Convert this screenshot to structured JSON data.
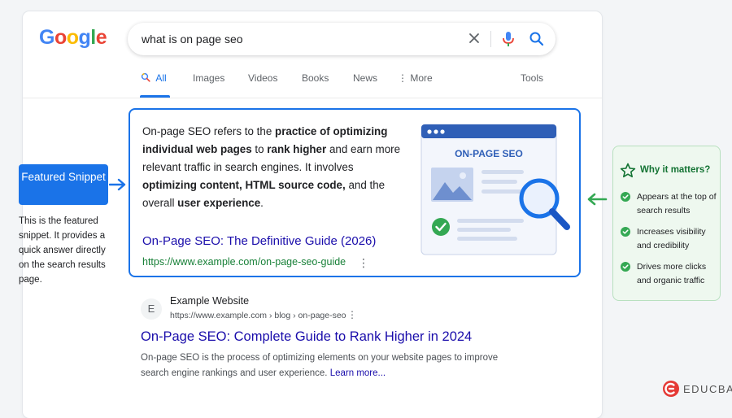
{
  "logo": {
    "letters": [
      "G",
      "o",
      "o",
      "g",
      "l",
      "e"
    ]
  },
  "search": {
    "query": "what is on page seo"
  },
  "tabs": [
    {
      "label": "All",
      "active": true
    },
    {
      "label": "Images"
    },
    {
      "label": "Videos"
    },
    {
      "label": "Books"
    },
    {
      "label": "News"
    },
    {
      "label": "More"
    },
    {
      "label": "Tools"
    }
  ],
  "featured": {
    "text_parts": [
      "On-page SEO refers to the ",
      "practice of optimizing individual web pages",
      " to ",
      "rank higher",
      " and earn more relevant traffic in search engines. It involves ",
      "optimizing content, HTML source code,",
      " and the overall ",
      "user experience",
      "."
    ],
    "title": "On-Page SEO: The Definitive Guide (2026)",
    "url": "https://www.example.com/on-page-seo-guide",
    "illustration_label": "ON-PAGE SEO"
  },
  "annotation": {
    "badge": "Featured Snippet",
    "note": "This is the featured snippet. It provides a quick answer directly on the search results page."
  },
  "why": {
    "title": "Why it matters?",
    "items": [
      "Appears at the top of search results",
      "Increases visibility and credibility",
      "Drives more clicks and organic traffic"
    ]
  },
  "result2": {
    "favicon_letter": "E",
    "site_name": "Example Website",
    "breadcrumb": "https://www.example.com › blog › on-page-seo",
    "title": "On-Page SEO: Complete Guide to Rank Higher in 2024",
    "description": "On-page SEO is the process of optimizing elements on your website pages to improve search engine rankings and user experience.",
    "learn_more": "Learn more..."
  },
  "watermark": "EDUCBA",
  "colors": {
    "accent": "#1a73e8",
    "link": "#1a0dab",
    "url_green": "#188038",
    "why_green": "#137333",
    "educba_red": "#e53935"
  }
}
